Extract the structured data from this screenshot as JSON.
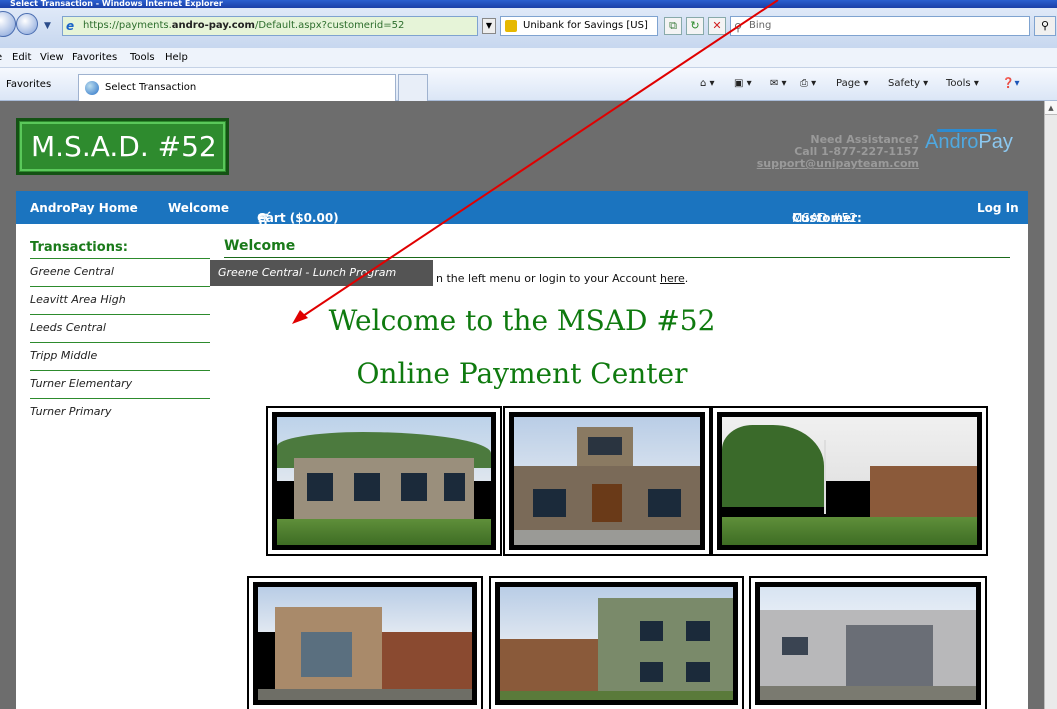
{
  "browser": {
    "title": "Select Transaction - Windows Internet Explorer",
    "url_prefix": "https://payments.",
    "url_domain": "andro-pay.com",
    "url_path": "/Default.aspx?customerid=52",
    "cert_label": "Unibank for Savings [US]",
    "search_placeholder": "Bing",
    "menu": [
      "e",
      "Edit",
      "View",
      "Favorites",
      "Tools",
      "Help"
    ],
    "favorites_label": "Favorites",
    "tab_title": "Select Transaction",
    "commands": [
      "Page ▾",
      "Safety ▾",
      "Tools ▾"
    ]
  },
  "header": {
    "logo_text": "M.S.A.D. #52",
    "assist_line1": "Need Assistance?",
    "assist_line2": "Call 1-877-227-1157",
    "assist_email": "support@unipayteam.com",
    "andro": "Andro",
    "pay": "Pay"
  },
  "nav": {
    "home": "AndroPay Home",
    "welcome": "Welcome",
    "cart": "Cart ($0.00)",
    "customer_label": "Customer:",
    "customer_value": "MSAD #52",
    "login": "Log In"
  },
  "sidebar": {
    "heading": "Transactions:",
    "items": [
      {
        "label": "Greene Central"
      },
      {
        "label": "Leavitt Area High"
      },
      {
        "label": "Leeds Central"
      },
      {
        "label": "Tripp Middle"
      },
      {
        "label": "Turner Elementary"
      },
      {
        "label": "Turner Primary"
      }
    ]
  },
  "main": {
    "heading": "Welcome",
    "instruction": "n the left menu or login to your Account ",
    "here_link": "here",
    "period": ".",
    "tooltip": "Greene Central - Lunch Program",
    "title_line1": "Welcome to the MSAD #52",
    "title_line2": "Online Payment Center"
  },
  "colors": {
    "nav_blue": "#1b74bf",
    "brand_green": "#2e8b2e",
    "heading_green": "#1a7a1a",
    "annotation_arrow": "#e00000"
  }
}
